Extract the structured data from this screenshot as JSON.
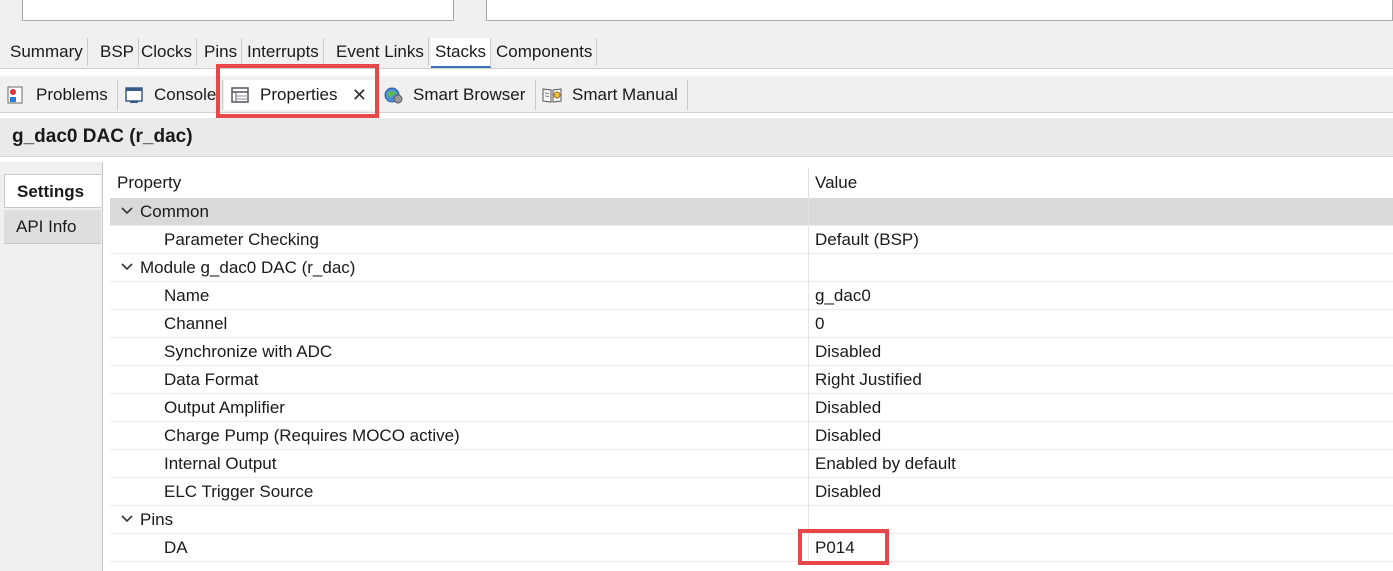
{
  "config_tabs": [
    "Summary",
    "BSP",
    "Clocks",
    "Pins",
    "Interrupts",
    "Event Links",
    "Stacks",
    "Components"
  ],
  "view_tabs": {
    "problems": "Problems",
    "console": "Console",
    "properties": "Properties",
    "smart_browser": "Smart Browser",
    "smart_manual": "Smart Manual"
  },
  "panel_title": "g_dac0 DAC (r_dac)",
  "side_tabs": {
    "settings": "Settings",
    "api_info": "API Info"
  },
  "table": {
    "col_property": "Property",
    "col_value": "Value",
    "groups": [
      {
        "name": "Common",
        "rows": [
          {
            "name": "Parameter Checking",
            "value": "Default (BSP)"
          }
        ]
      },
      {
        "name": "Module g_dac0 DAC (r_dac)",
        "rows": [
          {
            "name": "Name",
            "value": "g_dac0"
          },
          {
            "name": "Channel",
            "value": "0"
          },
          {
            "name": "Synchronize with ADC",
            "value": "Disabled"
          },
          {
            "name": "Data Format",
            "value": "Right Justified"
          },
          {
            "name": "Output Amplifier",
            "value": "Disabled"
          },
          {
            "name": "Charge Pump (Requires MOCO active)",
            "value": "Disabled"
          },
          {
            "name": "Internal Output",
            "value": "Enabled by default"
          },
          {
            "name": "ELC Trigger Source",
            "value": "Disabled"
          }
        ]
      },
      {
        "name": "Pins",
        "rows": [
          {
            "name": "DA",
            "value": "P014"
          }
        ]
      }
    ]
  },
  "colors": {
    "highlight": "#e8474a",
    "active_tab_underline": "#3b73b9",
    "selected_row": "#d9d9d9"
  },
  "icons": [
    "problems-icon",
    "console-icon",
    "properties-icon",
    "close-icon",
    "smart-browser-icon",
    "smart-manual-icon",
    "chevron-down-icon"
  ]
}
